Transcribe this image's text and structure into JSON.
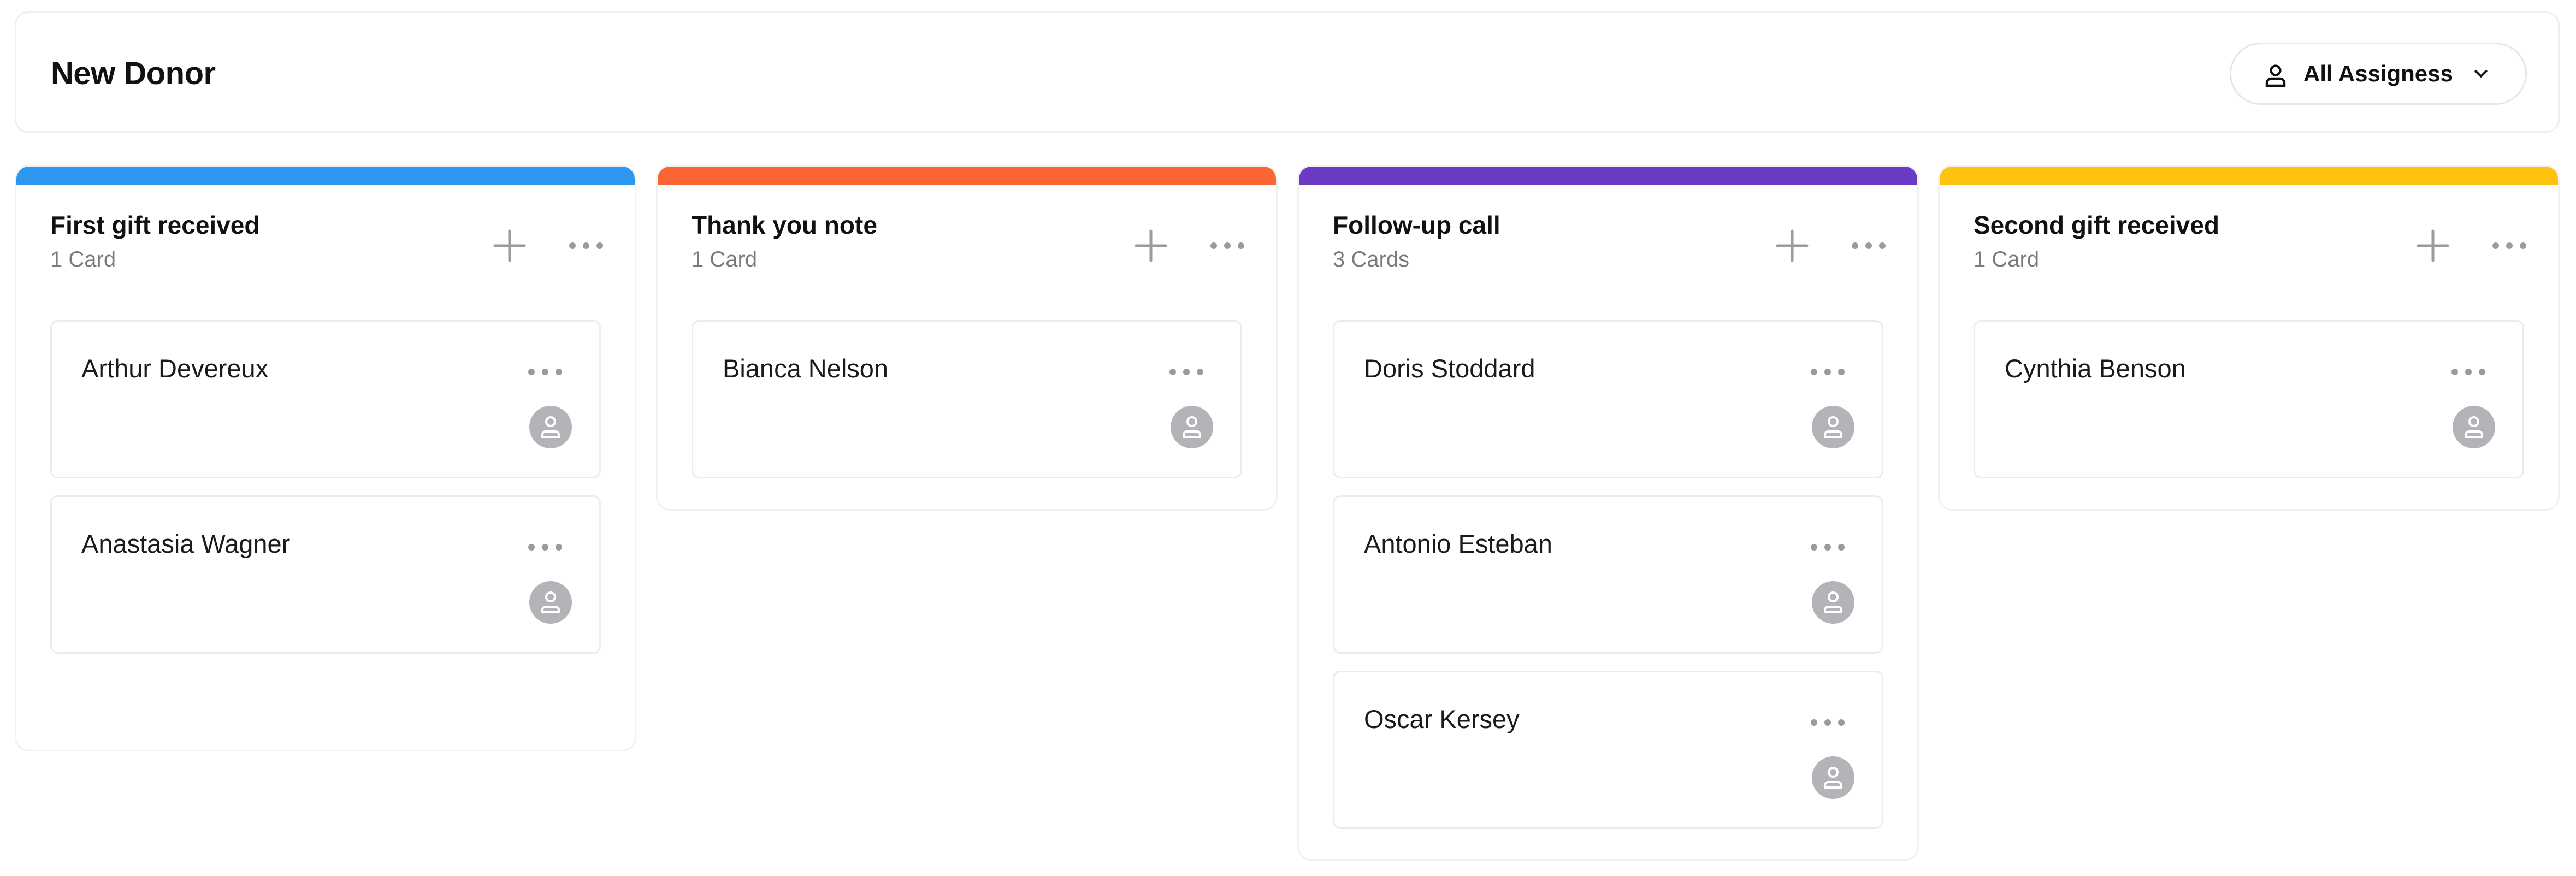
{
  "board": {
    "title": "New Donor",
    "assignee_filter": {
      "label": "All Assigness",
      "icon": "person-icon",
      "dropdown_icon": "chevron-down-icon"
    }
  },
  "columns": [
    {
      "title": "First gift received",
      "count": "1 Card",
      "color": "#2D97F0",
      "cards": [
        {
          "name": "Arthur Devereux"
        },
        {
          "name": "Anastasia Wagner"
        }
      ]
    },
    {
      "title": "Thank you note",
      "count": "1 Card",
      "color": "#FA6533",
      "cards": [
        {
          "name": "Bianca Nelson"
        }
      ]
    },
    {
      "title": "Follow-up call",
      "count": "3 Cards",
      "color": "#6A3BC4",
      "cards": [
        {
          "name": "Doris Stoddard"
        },
        {
          "name": "Antonio Esteban"
        },
        {
          "name": "Oscar Kersey"
        }
      ]
    },
    {
      "title": "Second gift received",
      "count": "1 Card",
      "color": "#FFC20E",
      "cards": [
        {
          "name": "Cynthia Benson"
        }
      ]
    }
  ],
  "icons": {
    "add": "plus-icon",
    "more": "more-horizontal-icon",
    "avatar": "user-avatar-icon"
  }
}
